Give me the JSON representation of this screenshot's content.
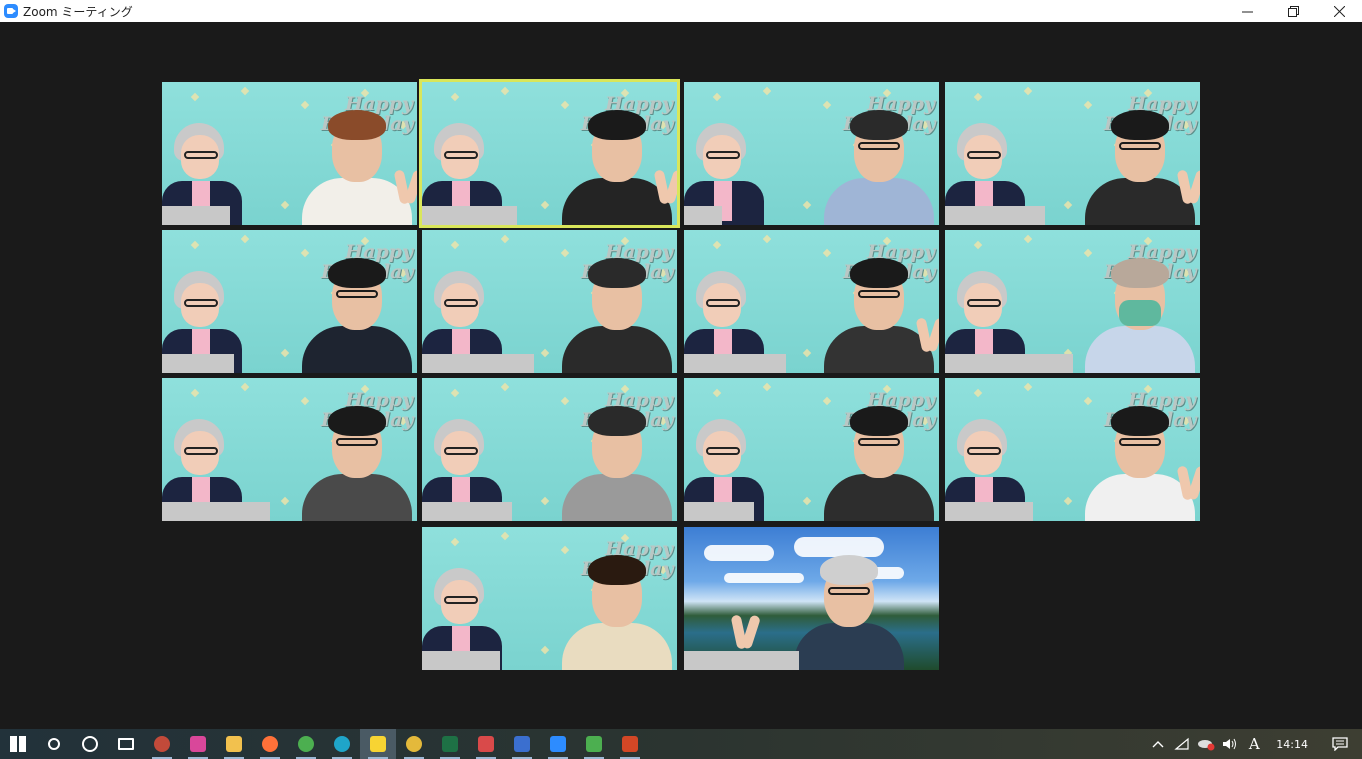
{
  "window": {
    "title": "Zoom ミーティング"
  },
  "gallery": {
    "background_text": "Happy Birthday",
    "active_speaker_index": 1,
    "tiles": [
      {
        "id": 1,
        "person": {
          "hair": "#8a4b2a",
          "body": "#f2efe9",
          "glasses": false,
          "hand": true,
          "mask": false
        }
      },
      {
        "id": 2,
        "person": {
          "hair": "#1a1a1a",
          "body": "#242424",
          "glasses": false,
          "hand": true,
          "mask": false
        }
      },
      {
        "id": 3,
        "person": {
          "hair": "#2a2a2a",
          "body": "#9fb5d6",
          "glasses": true,
          "hand": false,
          "mask": false
        }
      },
      {
        "id": 4,
        "person": {
          "hair": "#1a1a1a",
          "body": "#2a2a2a",
          "glasses": true,
          "hand": true,
          "mask": false
        }
      },
      {
        "id": 5,
        "person": {
          "hair": "#1a1a1a",
          "body": "#1e2430",
          "glasses": true,
          "hand": false,
          "mask": false
        }
      },
      {
        "id": 6,
        "person": {
          "hair": "#2a2a2a",
          "body": "#2a2a2a",
          "glasses": false,
          "hand": false,
          "mask": false
        }
      },
      {
        "id": 7,
        "person": {
          "hair": "#1a1a1a",
          "body": "#333333",
          "glasses": true,
          "hand": true,
          "mask": false
        }
      },
      {
        "id": 8,
        "person": {
          "hair": "#b8a89a",
          "body": "#c7d6ea",
          "glasses": false,
          "hand": false,
          "mask": true
        }
      },
      {
        "id": 9,
        "person": {
          "hair": "#1a1a1a",
          "body": "#4a4a4a",
          "glasses": true,
          "hand": false,
          "mask": false
        }
      },
      {
        "id": 10,
        "person": {
          "hair": "#2a2a2a",
          "body": "#9a9a9a",
          "glasses": false,
          "hand": false,
          "mask": false
        }
      },
      {
        "id": 11,
        "person": {
          "hair": "#1a1a1a",
          "body": "#2d2d2d",
          "glasses": true,
          "hand": false,
          "mask": false
        }
      },
      {
        "id": 12,
        "person": {
          "hair": "#1a1a1a",
          "body": "#f0f0f0",
          "glasses": true,
          "hand": true,
          "mask": false
        }
      },
      {
        "id": 13,
        "person": {
          "hair": "#2a1a10",
          "body": "#e9dcc0",
          "glasses": false,
          "hand": false,
          "mask": false
        }
      },
      {
        "id": 14,
        "scenic": true,
        "person": {
          "hair": "#cfcfcf",
          "body": "#2b3d52",
          "glasses": true,
          "hand": true,
          "mask": false
        }
      }
    ]
  },
  "taskbar": {
    "clock": "14:14",
    "input_language": "A",
    "items": [
      {
        "name": "start-button-icon",
        "color": "#ffffff"
      },
      {
        "name": "search-icon",
        "color": "#ffffff"
      },
      {
        "name": "cortana-icon",
        "color": "#ffffff"
      },
      {
        "name": "task-view-icon",
        "color": "#ffffff"
      },
      {
        "name": "app-obs-icon",
        "color": "#c24a3a"
      },
      {
        "name": "app-photo-icon",
        "color": "#d9479a"
      },
      {
        "name": "file-explorer-icon",
        "color": "#f2c14e"
      },
      {
        "name": "firefox-icon",
        "color": "#ff7139"
      },
      {
        "name": "chrome-icon",
        "color": "#4caf50"
      },
      {
        "name": "edge-icon",
        "color": "#1fa5c9"
      },
      {
        "name": "sticky-notes-icon",
        "color": "#f7d433"
      },
      {
        "name": "slack-icon",
        "color": "#e4b93b"
      },
      {
        "name": "excel-icon",
        "color": "#1e7145"
      },
      {
        "name": "app-red-icon",
        "color": "#d94a4a"
      },
      {
        "name": "app-blue-icon",
        "color": "#3b6fcf"
      },
      {
        "name": "zoom-icon",
        "color": "#2d8cff"
      },
      {
        "name": "app-monitor-icon",
        "color": "#4caf50"
      },
      {
        "name": "powerpoint-icon",
        "color": "#d24726"
      }
    ]
  }
}
